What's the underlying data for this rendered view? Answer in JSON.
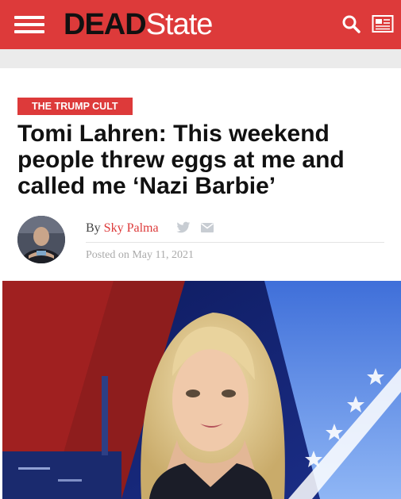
{
  "header": {
    "brand_bold": "DEAD",
    "brand_light": "State",
    "icons": [
      "menu-icon",
      "search-icon",
      "newspaper-icon"
    ]
  },
  "article": {
    "category": "THE TRUMP CULT",
    "title": "Tomi Lahren: This weekend people threw eggs at me and called me ‘Nazi Barbie’",
    "byline_prefix": "By",
    "author": "Sky Palma",
    "posted": "Posted on May 11, 2021",
    "share_icons": [
      "twitter-icon",
      "mail-icon"
    ]
  },
  "colors": {
    "brand_red": "#dd3a3a",
    "header_gray": "#ebebeb",
    "title_text": "#111111",
    "meta_gray": "#aaaaaa"
  }
}
